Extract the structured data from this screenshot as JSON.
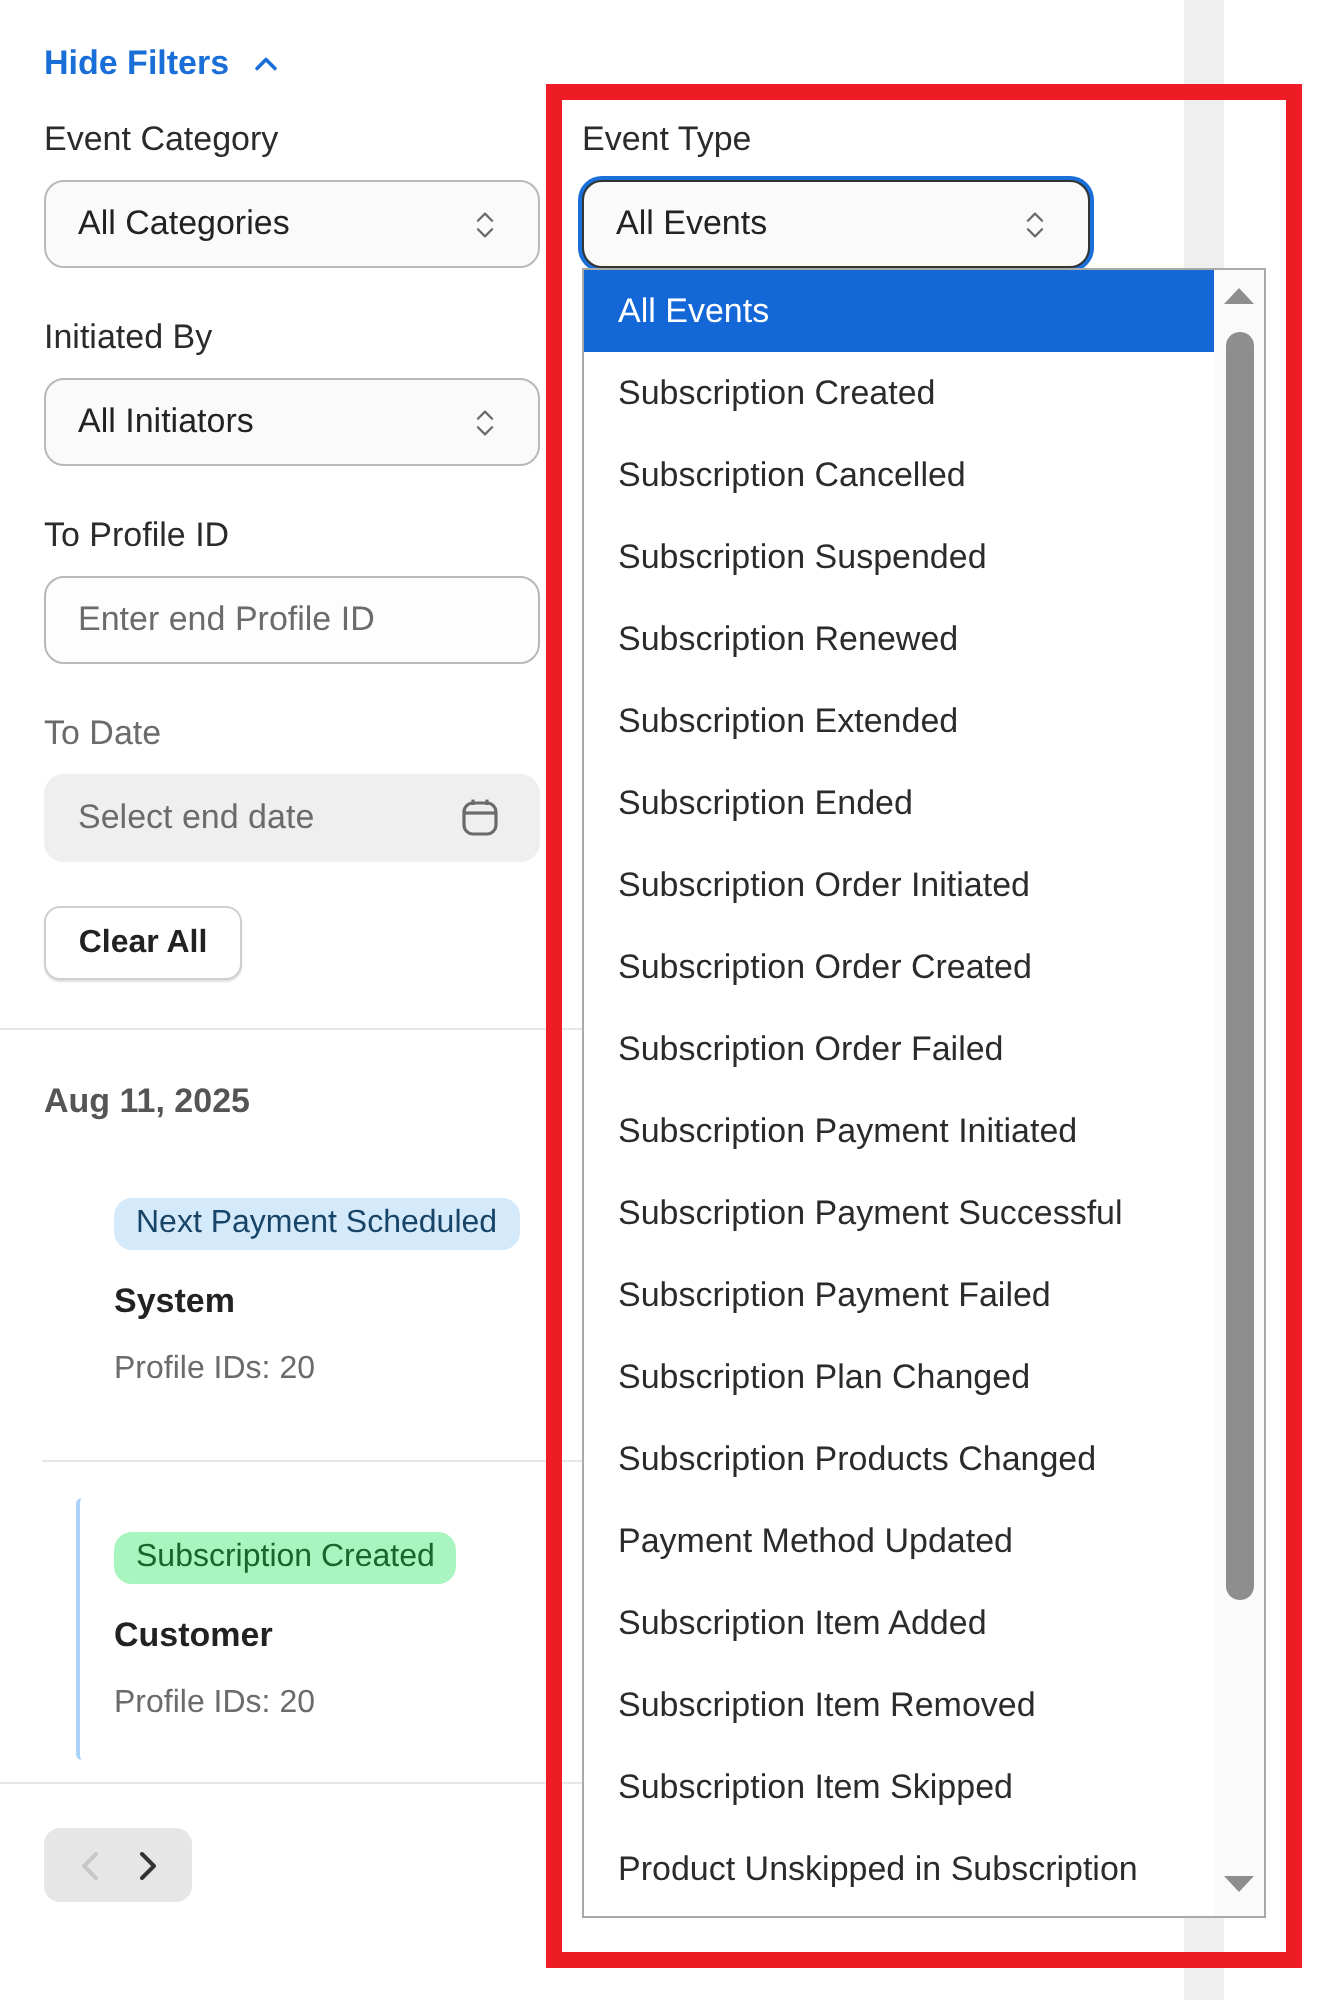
{
  "filters_toggle": {
    "label": "Hide Filters",
    "expanded": true
  },
  "filter_columns": [
    {
      "fields": [
        {
          "kind": "select",
          "label": "Event Category",
          "value": "All Categories",
          "disabled": false,
          "open": false
        },
        {
          "kind": "select",
          "label": "Initiated By",
          "value": "All Initiators",
          "disabled": false,
          "open": false
        },
        {
          "kind": "text",
          "label": "To Profile ID",
          "placeholder": "Enter end Profile ID",
          "disabled": false
        },
        {
          "kind": "date",
          "label": "To Date",
          "placeholder": "Select end date",
          "disabled": true
        }
      ]
    },
    {
      "fields": [
        {
          "kind": "select",
          "label": "Event Type",
          "value": "All Events",
          "disabled": false,
          "open": true,
          "highlighted": true,
          "options": [
            {
              "label": "All Events",
              "selected": true
            },
            {
              "label": "Subscription Created",
              "selected": false
            },
            {
              "label": "Subscription Cancelled",
              "selected": false
            },
            {
              "label": "Subscription Suspended",
              "selected": false
            },
            {
              "label": "Subscription Renewed",
              "selected": false
            },
            {
              "label": "Subscription Extended",
              "selected": false
            },
            {
              "label": "Subscription Ended",
              "selected": false
            },
            {
              "label": "Subscription Order Initiated",
              "selected": false
            },
            {
              "label": "Subscription Order Created",
              "selected": false
            },
            {
              "label": "Subscription Order Failed",
              "selected": false
            },
            {
              "label": "Subscription Payment Initiated",
              "selected": false
            },
            {
              "label": "Subscription Payment Successful",
              "selected": false
            },
            {
              "label": "Subscription Payment Failed",
              "selected": false
            },
            {
              "label": "Subscription Plan Changed",
              "selected": false
            },
            {
              "label": "Subscription Products Changed",
              "selected": false
            },
            {
              "label": "Payment Method Updated",
              "selected": false
            },
            {
              "label": "Subscription Item Added",
              "selected": false
            },
            {
              "label": "Subscription Item Removed",
              "selected": false
            },
            {
              "label": "Subscription Item Skipped",
              "selected": false
            },
            {
              "label": "Product Unskipped in Subscription",
              "selected": false
            }
          ]
        }
      ]
    }
  ],
  "clear_button": "Clear All",
  "event_groups": [
    {
      "date": "Aug 11, 2025",
      "events": [
        {
          "badge": "Next Payment Scheduled",
          "color": "#d4eafb",
          "initiator": "System",
          "profile_ids": "Profile IDs: 20",
          "selected": false
        },
        {
          "badge": "Subscription Created",
          "color": "#a9f5bf",
          "initiator": "Customer",
          "profile_ids": "Profile IDs: 20",
          "selected": true
        }
      ]
    }
  ],
  "pagination": {
    "previous_disabled": true,
    "next_disabled": false
  }
}
